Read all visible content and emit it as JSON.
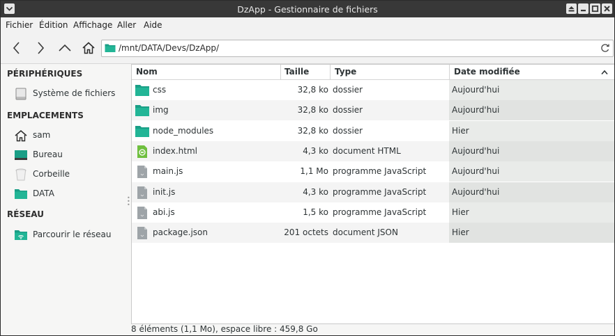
{
  "window": {
    "title": "DzApp - Gestionnaire de fichiers"
  },
  "menu": [
    "Fichier",
    "Édition",
    "Affichage",
    "Aller",
    "Aide"
  ],
  "address": {
    "path": "/mnt/DATA/Devs/DzApp/"
  },
  "sidebar": {
    "sections": [
      {
        "heading": "PÉRIPHÉRIQUES",
        "items": [
          {
            "label": "Système de fichiers",
            "icon": "drive-icon"
          }
        ]
      },
      {
        "heading": "EMPLACEMENTS",
        "items": [
          {
            "label": "sam",
            "icon": "home-icon"
          },
          {
            "label": "Bureau",
            "icon": "desktop-icon"
          },
          {
            "label": "Corbeille",
            "icon": "trash-icon"
          },
          {
            "label": "DATA",
            "icon": "folder-icon"
          }
        ]
      },
      {
        "heading": "RÉSEAU",
        "items": [
          {
            "label": "Parcourir le réseau",
            "icon": "network-icon"
          }
        ]
      }
    ]
  },
  "columns": {
    "name": "Nom",
    "size": "Taille",
    "type": "Type",
    "date": "Date modifiée"
  },
  "files": [
    {
      "name": "css",
      "size": "32,8 ko",
      "type": "dossier",
      "date": "Aujourd'hui",
      "icon": "folder-icon"
    },
    {
      "name": "img",
      "size": "32,8 ko",
      "type": "dossier",
      "date": "Aujourd'hui",
      "icon": "folder-icon"
    },
    {
      "name": "node_modules",
      "size": "32,8 ko",
      "type": "dossier",
      "date": "Hier",
      "icon": "folder-icon"
    },
    {
      "name": "index.html",
      "size": "4,3 ko",
      "type": "document HTML",
      "date": "Aujourd'hui",
      "icon": "html-file-icon"
    },
    {
      "name": "main.js",
      "size": "1,1 Mo",
      "type": "programme JavaScript",
      "date": "Aujourd'hui",
      "icon": "js-file-icon"
    },
    {
      "name": "init.js",
      "size": "4,3 ko",
      "type": "programme JavaScript",
      "date": "Aujourd'hui",
      "icon": "js-file-icon"
    },
    {
      "name": "abi.js",
      "size": "1,5 ko",
      "type": "programme JavaScript",
      "date": "Hier",
      "icon": "js-file-icon"
    },
    {
      "name": "package.json",
      "size": "201 octets",
      "type": "document JSON",
      "date": "Hier",
      "icon": "json-file-icon"
    }
  ],
  "status": "8 éléments (1,1 Mo), espace libre : 459,8 Go",
  "colors": {
    "titlebar": "#383838",
    "folder": "#1a9e86",
    "accent": "#1fa087"
  }
}
